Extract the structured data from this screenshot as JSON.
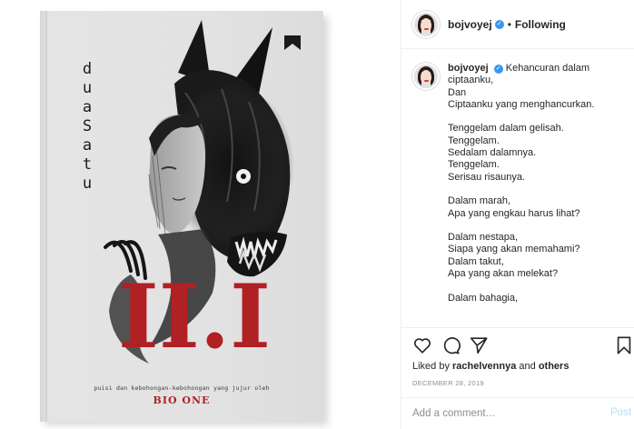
{
  "book": {
    "publisher_logo": "bookmark-chevron-logo",
    "title_letters": [
      "d",
      "u",
      "a",
      "S",
      "a",
      "t",
      "u"
    ],
    "numeral": "II.I",
    "subtitle": "puisi dan kebohongan-kebohongan yang jujur oleh",
    "author": "BIO ONE",
    "colors": {
      "cover": "#e2e2e2",
      "accent_red": "#b02024",
      "ink": "#1c1c1c"
    }
  },
  "header": {
    "username": "bojvoyej",
    "separator": "•",
    "follow_status": "Following"
  },
  "caption": {
    "username": "bojvoyej",
    "first_line": "Kehancuran dalam",
    "lines": [
      "ciptaanku,",
      "Dan",
      "Ciptaanku yang menghancurkan.",
      "",
      "Tenggelam dalam gelisah.",
      "Tenggelam.",
      "Sedalam dalamnya.",
      "Tenggelam.",
      "Serisau risaunya.",
      "",
      "Dalam marah,",
      "Apa yang engkau harus lihat?",
      "",
      "Dalam nestapa,",
      "Siapa yang akan memahami?",
      "Dalam takut,",
      "Apa yang akan melekat?",
      "",
      "Dalam bahagia,"
    ]
  },
  "actions": {
    "icons": [
      "heart-icon",
      "comment-icon",
      "share-icon",
      "bookmark-icon"
    ],
    "likes_prefix": "Liked by ",
    "likes_user": "rachelvennya",
    "likes_and": " and ",
    "likes_others": "others",
    "date": "DECEMBER 28, 2019"
  },
  "comment": {
    "placeholder": "Add a comment…",
    "post_label": "Post"
  },
  "colors": {
    "link_blue": "#3897f0",
    "muted": "#8e8e8e",
    "post_disabled": "#b2dffc",
    "border": "#efefef"
  }
}
